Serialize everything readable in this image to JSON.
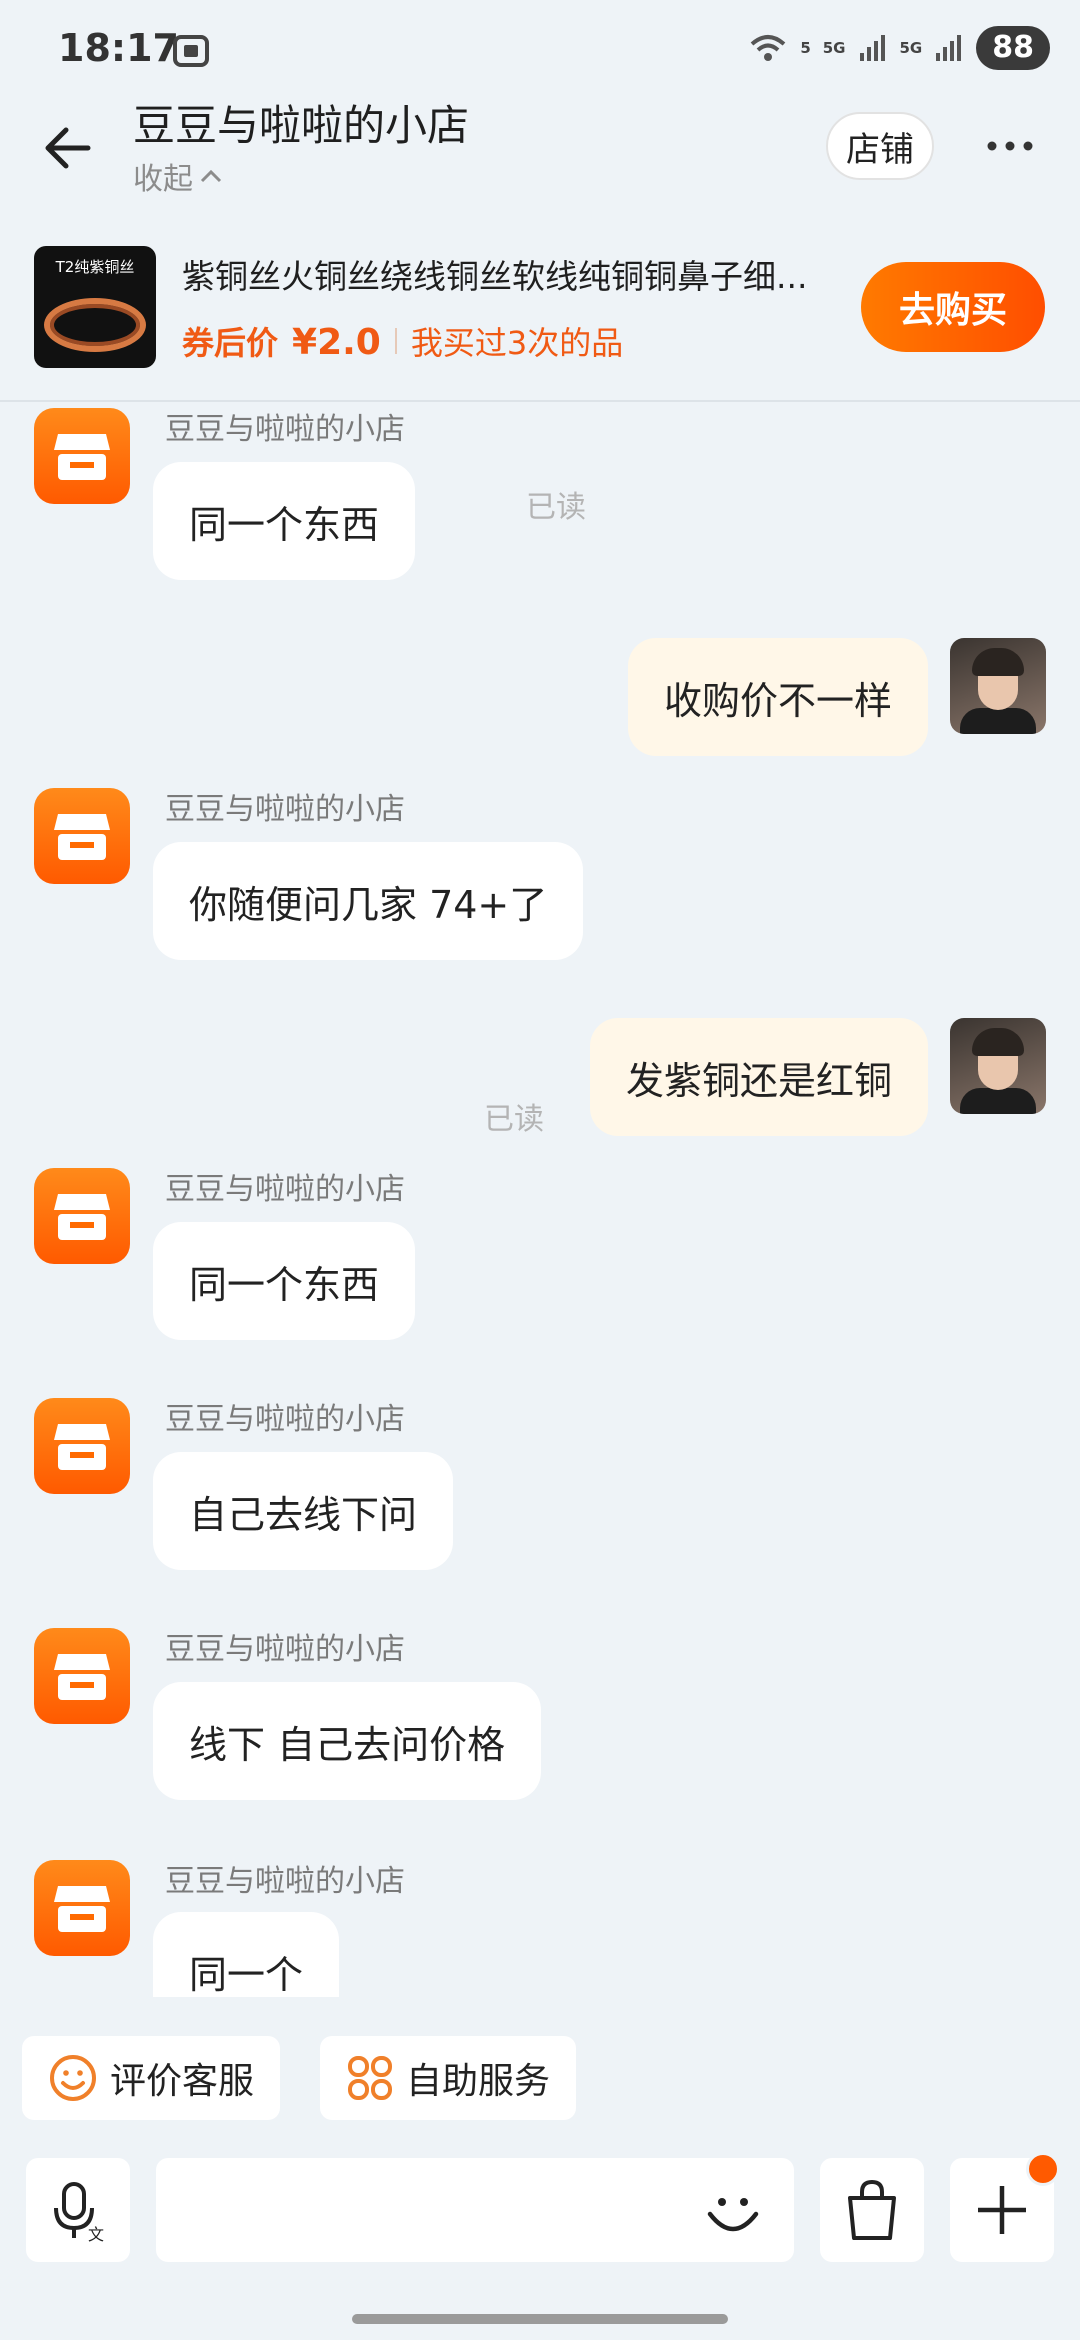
{
  "status_bar": {
    "time": "18:17",
    "net1": "5G",
    "net2": "5G",
    "wifi_label": "5",
    "battery": "88"
  },
  "header": {
    "title": "豆豆与啦啦的小店",
    "collapse_label": "收起",
    "store_button": "店铺"
  },
  "product": {
    "image_tag": "T2纯紫铜丝",
    "title": "紫铜丝火铜丝绕线铜丝软线纯铜铜鼻子细...",
    "coupon_label": "券后价",
    "price": "¥2.0",
    "bought_text": "我买过3次的品",
    "buy_button": "去购买"
  },
  "chat": {
    "messages": [
      {
        "side": "in",
        "sender": "豆豆与啦啦的小店",
        "text": "同一个东西"
      },
      {
        "side": "out",
        "text": "收购价不一样",
        "read": "已读"
      },
      {
        "side": "in",
        "sender": "豆豆与啦啦的小店",
        "text": "你随便问几家  74+了"
      },
      {
        "side": "out",
        "text": "发紫铜还是红铜",
        "read": "已读"
      },
      {
        "side": "in",
        "sender": "豆豆与啦啦的小店",
        "text": "同一个东西"
      },
      {
        "side": "in",
        "sender": "豆豆与啦啦的小店",
        "text": "自己去线下问"
      },
      {
        "side": "in",
        "sender": "豆豆与啦啦的小店",
        "text": "线下 自己去问价格"
      },
      {
        "side": "in",
        "sender": "豆豆与啦啦的小店",
        "text": "同一个"
      }
    ]
  },
  "quick_actions": {
    "rate": "评价客服",
    "self_service": "自助服务"
  },
  "input": {
    "placeholder": ""
  },
  "colors": {
    "accent": "#ff5a00",
    "price": "#f05a14",
    "background": "#eef3f7"
  }
}
